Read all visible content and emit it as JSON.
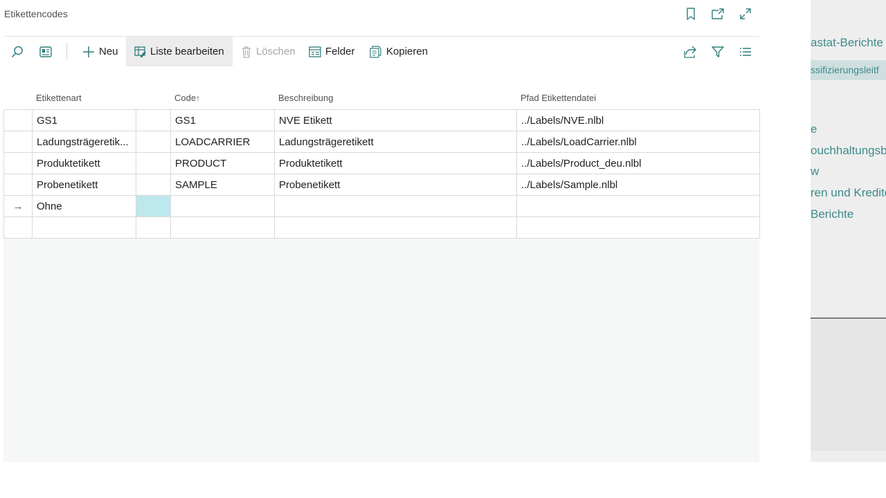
{
  "background": {
    "items": [
      "astat-Berichte",
      "ssifizierungsleitf",
      "e",
      "ouchhaltungsb",
      "w",
      "ren und Kredito",
      "Berichte"
    ]
  },
  "window": {
    "title": "Etikettencodes",
    "icons": [
      "bookmark-icon",
      "open-new-window-icon",
      "expand-icon"
    ]
  },
  "toolbar": {
    "new_label": "Neu",
    "edit_list_label": "Liste bearbeiten",
    "delete_label": "Löschen",
    "fields_label": "Felder",
    "copy_label": "Kopieren"
  },
  "columns": {
    "type": "Etikettenart",
    "code": "Code",
    "code_sort": "↑",
    "description": "Beschreibung",
    "path": "Pfad Etikettendatei"
  },
  "rows": [
    {
      "type": "GS1",
      "code": "GS1",
      "description": "NVE Etikett",
      "path": "../Labels/NVE.nlbl"
    },
    {
      "type": "Ladungsträgeretik...",
      "code": "LOADCARRIER",
      "description": "Ladungsträgeretikett",
      "path": "../Labels/LoadCarrier.nlbl"
    },
    {
      "type": "Produktetikett",
      "code": "PRODUCT",
      "description": "Produktetikett",
      "path": "../Labels/Product_deu.nlbl"
    },
    {
      "type": "Probenetikett",
      "code": "SAMPLE",
      "description": "Probenetikett",
      "path": "../Labels/Sample.nlbl"
    },
    {
      "type": "Ohne",
      "code": "",
      "description": "",
      "path": "",
      "marker": "→"
    },
    {
      "type": "",
      "code": "",
      "description": "",
      "path": ""
    }
  ],
  "colors": {
    "accent": "#2f7d7d",
    "selected_cell": "#bde8ee"
  }
}
